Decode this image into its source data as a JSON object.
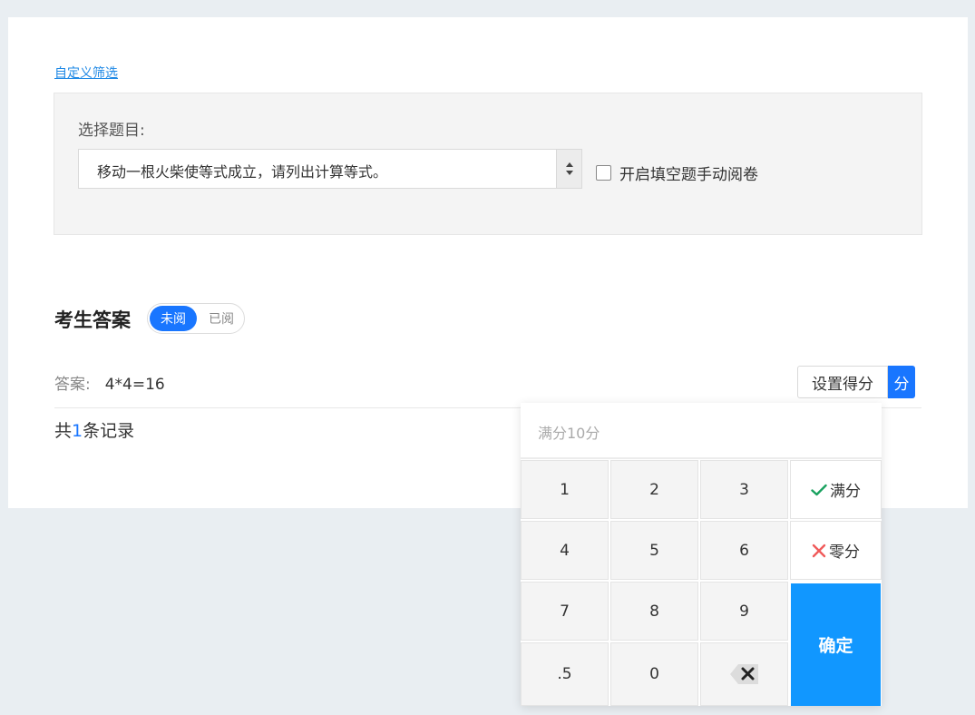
{
  "filter": {
    "custom_filter_link": "自定义筛选",
    "select_question_label": "选择题目:",
    "selected_question": "移动一根火柴使等式成立，请列出计算等式。",
    "manual_grading_label": "开启填空题手动阅卷",
    "manual_grading_checked": false
  },
  "answers": {
    "title": "考生答案",
    "toggle_unread": "未阅",
    "toggle_read": "已阅",
    "active_toggle": "未阅",
    "answer_label": "答案:",
    "answer_value": "4*4=16",
    "set_score_button": "设置得分",
    "score_unit": "分",
    "record_prefix": "共",
    "record_count": "1",
    "record_suffix": "条记录"
  },
  "keypad": {
    "hint": "满分10分",
    "keys": [
      "1",
      "2",
      "3",
      "4",
      "5",
      "6",
      "7",
      "8",
      "9",
      ".5",
      "0"
    ],
    "full_score_label": "满分",
    "zero_score_label": "零分",
    "confirm_label": "确定"
  },
  "colors": {
    "accent": "#1976ff",
    "confirm": "#1197ff",
    "check": "#19a15f",
    "cross": "#f05a5a"
  },
  "icons": {
    "select_arrow": "sort-arrows-icon",
    "full_score": "check-icon",
    "zero_score": "x-icon",
    "backspace": "backspace-icon"
  }
}
